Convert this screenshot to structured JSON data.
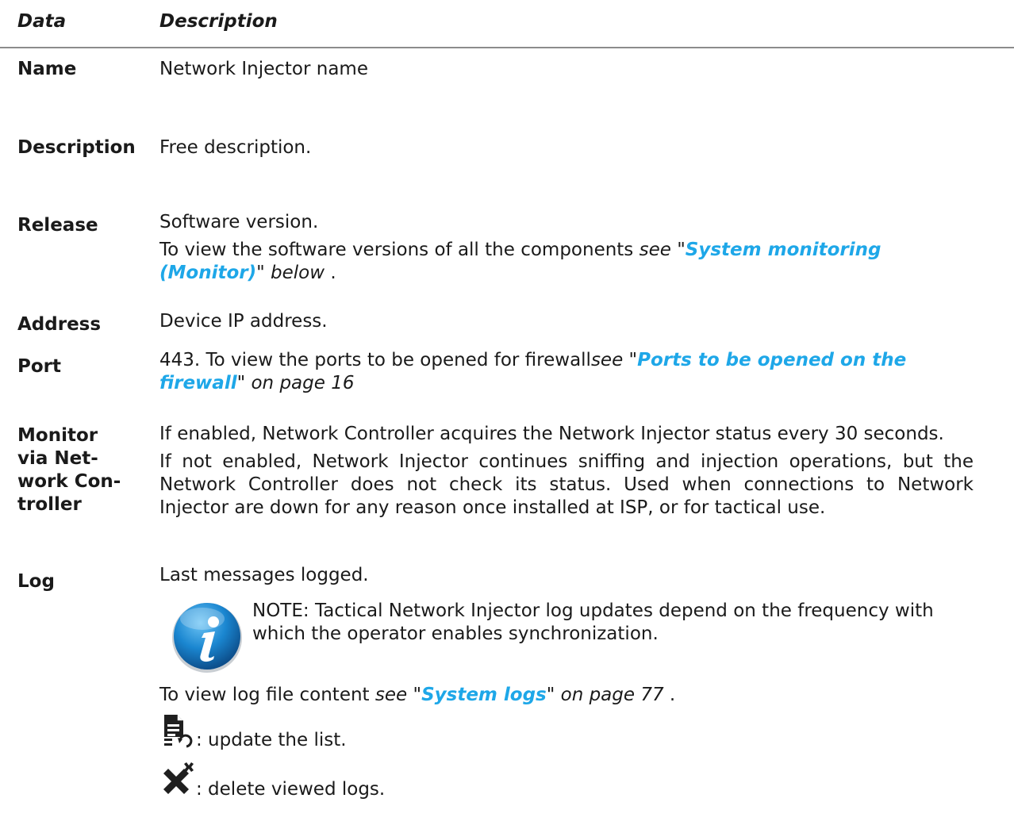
{
  "header": {
    "data_col": "Data",
    "description_col": "Description"
  },
  "rows": {
    "name": {
      "term": "Name",
      "desc": "Network Injector name"
    },
    "description": {
      "term": "Description",
      "desc": "Free description."
    },
    "release": {
      "term": "Release",
      "desc": "Software version.",
      "line2_pre": "To view the software versions of all the components ",
      "line2_see": "see \"",
      "line2_link": "System monitoring (Monitor)",
      "line2_after": "\" below",
      "line2_end": " ."
    },
    "address": {
      "term": "Address",
      "desc": "Device IP address."
    },
    "port": {
      "term": "Port",
      "pre": "443. To view the ports to be opened for firewall",
      "see": "see \"",
      "link": "Ports to be opened on the firewall",
      "after": "\" on page 16"
    },
    "monitor": {
      "term_l1": "Monitor",
      "term_l2": "via Net-",
      "term_l3": "work Con-",
      "term_l4": "troller",
      "p1": "If enabled, Network Controller acquires the Network Injector status every 30 seconds.",
      "p2": "If not enabled, Network Injector continues sniffing and injection operations, but the Network Controller does not check its status. Used when connections to Network Injector are down for any reason once installed at ISP, or for tactical use."
    },
    "log": {
      "term": "Log",
      "desc": "Last messages logged.",
      "note": "NOTE: Tactical Network Injector log updates depend on the frequency with which the operator enables synchronization.",
      "view_pre": "To view log file content ",
      "view_see": "see \"",
      "view_link": "System logs",
      "view_after": "\" on page 77",
      "view_end": " .",
      "update_label": ": update the list.",
      "delete_label": ": delete viewed logs."
    }
  },
  "colors": {
    "link": "#1ea7e8",
    "rule": "#8c8c8c",
    "info_icon": "#1a78bf"
  },
  "icons": [
    "info-icon",
    "refresh-list-icon",
    "delete-logs-icon"
  ]
}
